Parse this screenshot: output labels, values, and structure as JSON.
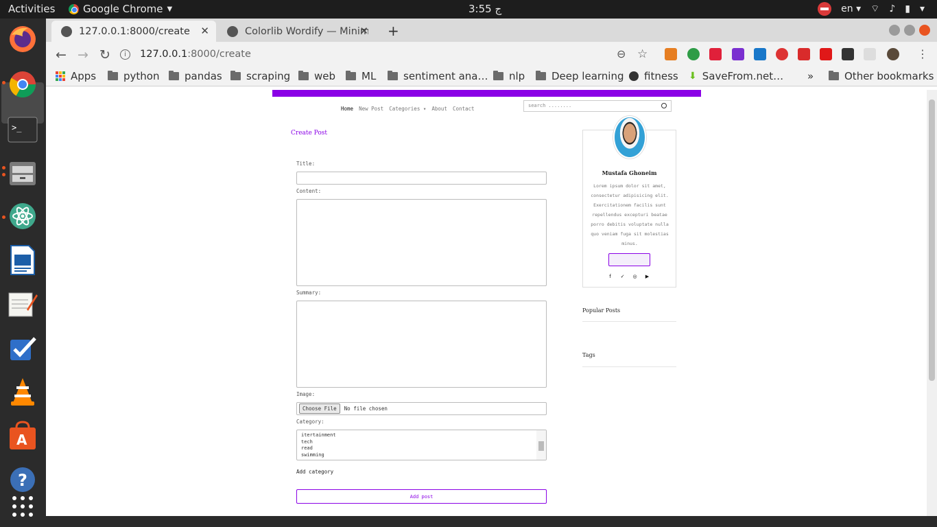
{
  "os": {
    "activities": "Activities",
    "app_name": "Google Chrome",
    "clock": "3:55 ج",
    "keyboard": "en"
  },
  "browser": {
    "tabs": [
      {
        "title": "127.0.0.1:8000/create",
        "active": true
      },
      {
        "title": "Colorlib Wordify — Minim",
        "active": false
      }
    ],
    "url_host": "127.0.0.1",
    "url_path": ":8000/create",
    "bookmarks": [
      "Apps",
      "python",
      "pandas",
      "scraping",
      "web",
      "ML",
      "sentiment ana…",
      "nlp",
      "Deep learning",
      "fitness",
      "SaveFrom.net…"
    ],
    "other_bookmarks": "Other bookmarks",
    "overflow": "»"
  },
  "site": {
    "nav": [
      "Home",
      "New Post",
      "Categories",
      "About",
      "Contact"
    ],
    "search_placeholder": "search ........",
    "accent": "#8a00e6"
  },
  "form": {
    "page_title": "Create Post",
    "title_label": "Title:",
    "content_label": "Content:",
    "summary_label": "Summary:",
    "image_label": "Image:",
    "choose_file": "Choose File",
    "no_file": "No file chosen",
    "category_label": "Category:",
    "categories": [
      "itertainment",
      "tech",
      "read",
      "swimming"
    ],
    "add_category": "Add category",
    "submit": "Add post"
  },
  "sidebar": {
    "author": "Mustafa Ghoneim",
    "bio": "Lorem ipsum dolor sit amet, consectetur adipisicing elit. Exercitationem facilis sunt repellendus excepturi beatae porro debitis voluptate nulla quo veniam fuga sit molestias minus.",
    "socials": [
      "facebook-icon",
      "twitter-icon",
      "instagram-icon",
      "youtube-icon"
    ],
    "popular_posts": "Popular Posts",
    "tags": "Tags"
  }
}
